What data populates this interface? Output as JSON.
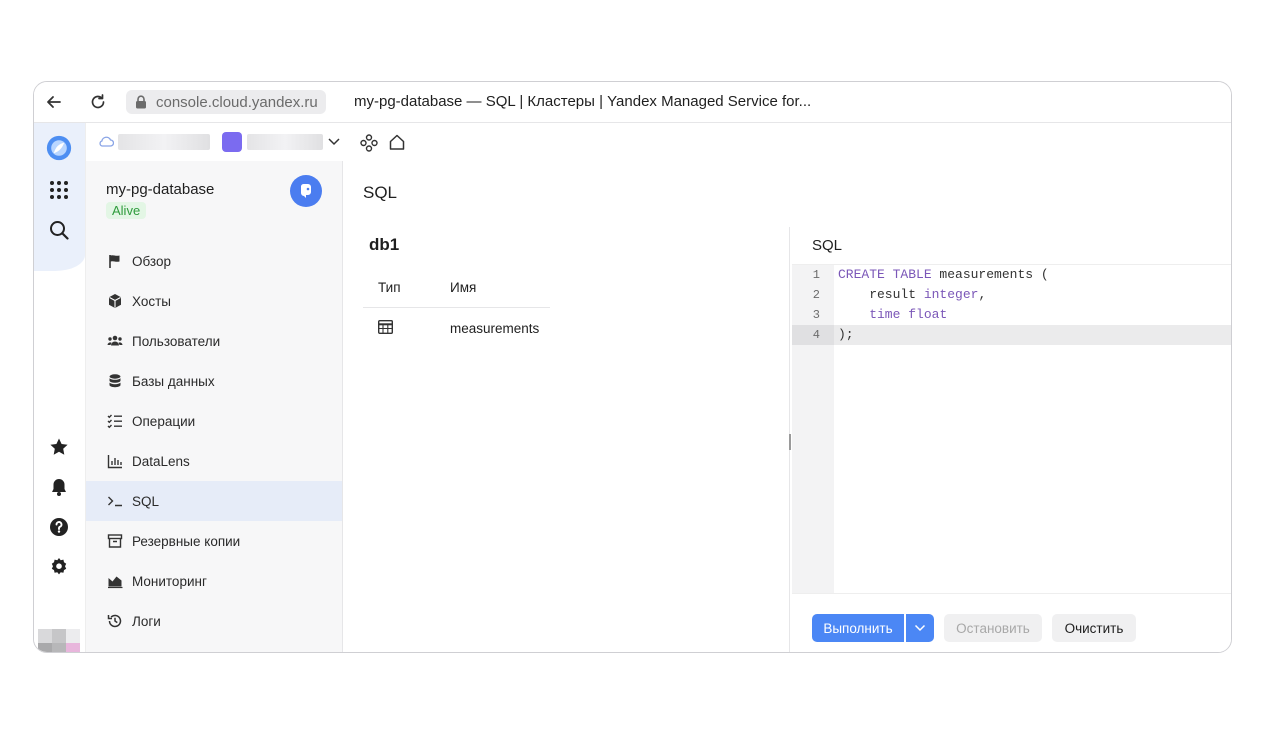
{
  "browser": {
    "url": "console.cloud.yandex.ru",
    "tab_title": "my-pg-database — SQL | Кластеры | Yandex Managed Service for..."
  },
  "cluster": {
    "name": "my-pg-database",
    "status": "Alive"
  },
  "menu": [
    {
      "label": "Обзор",
      "icon": "flag-icon"
    },
    {
      "label": "Хосты",
      "icon": "cube-icon"
    },
    {
      "label": "Пользователи",
      "icon": "users-icon"
    },
    {
      "label": "Базы данных",
      "icon": "database-icon"
    },
    {
      "label": "Операции",
      "icon": "checklist-icon"
    },
    {
      "label": "DataLens",
      "icon": "bar-chart-icon"
    },
    {
      "label": "SQL",
      "icon": "terminal-icon",
      "active": true
    },
    {
      "label": "Резервные копии",
      "icon": "archive-icon"
    },
    {
      "label": "Мониторинг",
      "icon": "chart-area-icon"
    },
    {
      "label": "Логи",
      "icon": "history-icon"
    }
  ],
  "main": {
    "title": "SQL",
    "db_name": "db1",
    "table_headers": {
      "type": "Тип",
      "name": "Имя"
    },
    "tables": [
      {
        "type_icon": "table-icon",
        "name": "measurements"
      }
    ],
    "editor_label": "SQL",
    "code_lines": [
      "1",
      "2",
      "3",
      "4"
    ],
    "code": {
      "l1_kw": "CREATE TABLE",
      "l1_rest": " measurements (",
      "l2_ident": "    result ",
      "l2_kw": "integer",
      "l2_rest": ",",
      "l3_kw1": "    time",
      "l3_sp": " ",
      "l3_kw2": "float",
      "l4": ");"
    },
    "buttons": {
      "run": "Выполнить",
      "stop": "Остановить",
      "clear": "Очистить"
    }
  },
  "colors": {
    "accent": "#4b87f5",
    "status_bg": "#e3f6e5",
    "status_text": "#2e9b3c",
    "keyword": "#7b57b8"
  }
}
